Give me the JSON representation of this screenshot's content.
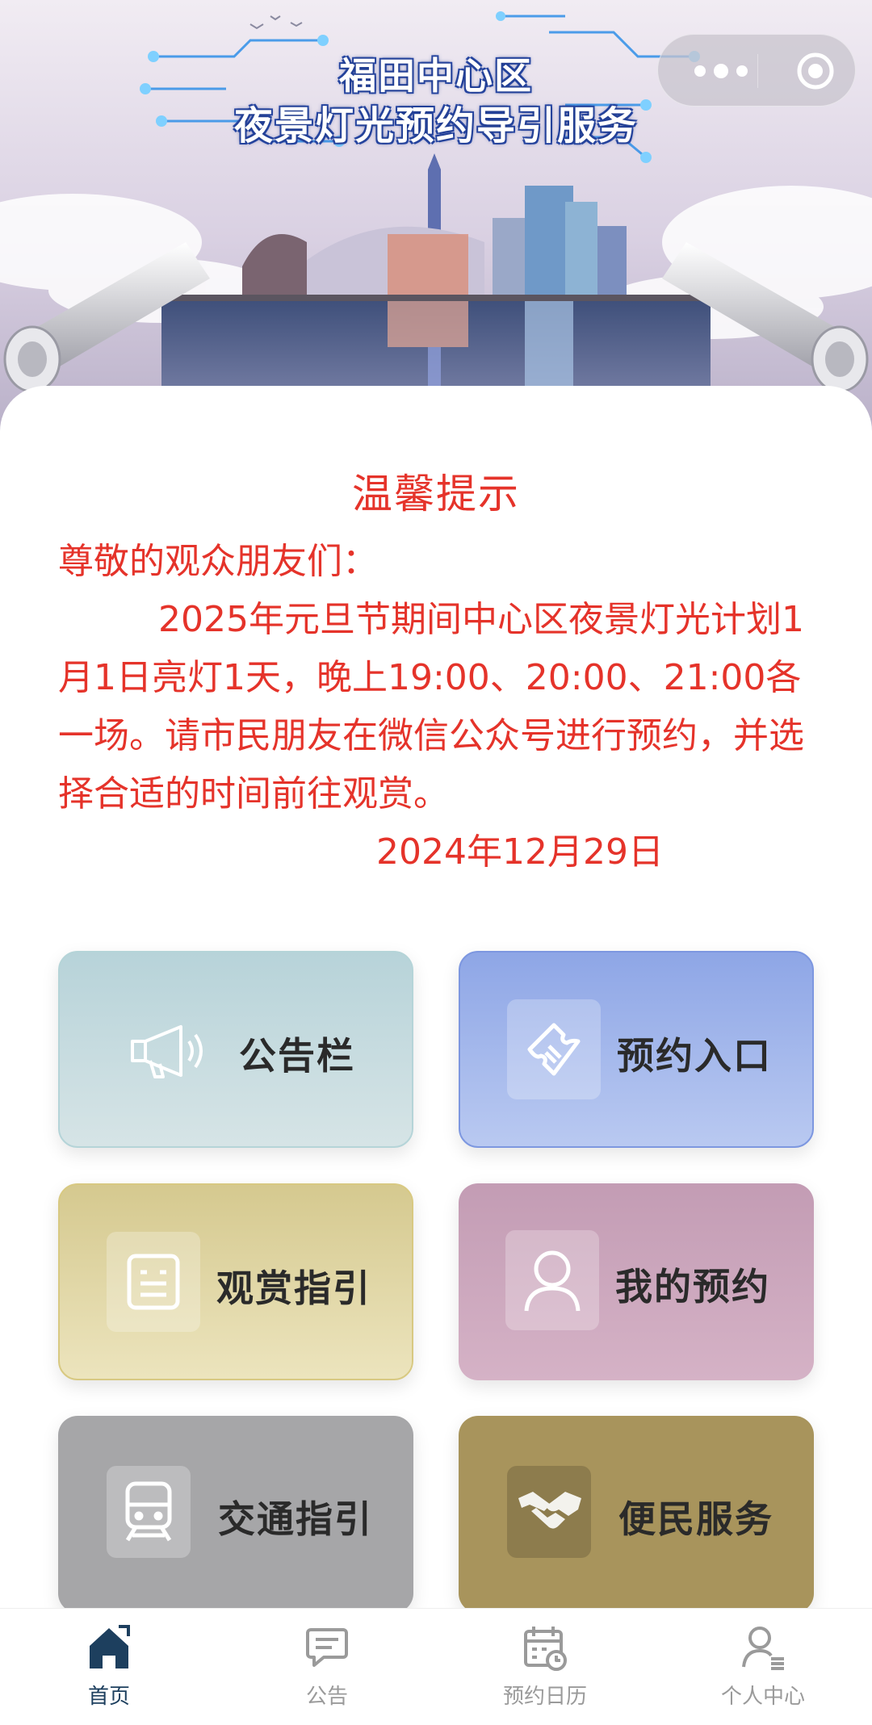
{
  "banner": {
    "title_line1": "福田中心区",
    "title_line2": "夜景灯光预约导引服务"
  },
  "capsule": {
    "more_icon": "more-dots-icon",
    "close_icon": "circle-target-icon"
  },
  "notice": {
    "title": "温馨提示",
    "greeting": "尊敬的观众朋友们：",
    "body": "2025年元旦节期间中心区夜景灯光计划1月1日亮灯1天，晚上19:00、20:00、21:00各一场。请市民朋友在微信公众号进行预约，并选择合适的时间前往观赏。",
    "date": "2024年12月29日",
    "color": "#e5332a"
  },
  "tiles": [
    {
      "label": "公告栏",
      "icon": "megaphone-icon"
    },
    {
      "label": "预约入口",
      "icon": "ticket-icon"
    },
    {
      "label": "观赏指引",
      "icon": "document-icon"
    },
    {
      "label": "我的预约",
      "icon": "user-icon"
    },
    {
      "label": "交通指引",
      "icon": "train-icon"
    },
    {
      "label": "便民服务",
      "icon": "handshake-icon"
    }
  ],
  "tabbar": {
    "items": [
      {
        "label": "首页",
        "icon": "home-icon",
        "active": true
      },
      {
        "label": "公告",
        "icon": "chat-icon",
        "active": false
      },
      {
        "label": "预约日历",
        "icon": "calendar-icon",
        "active": false
      },
      {
        "label": "个人中心",
        "icon": "person-icon",
        "active": false
      }
    ],
    "active_color": "#1d3f5e",
    "inactive_color": "#9a9a9a"
  }
}
